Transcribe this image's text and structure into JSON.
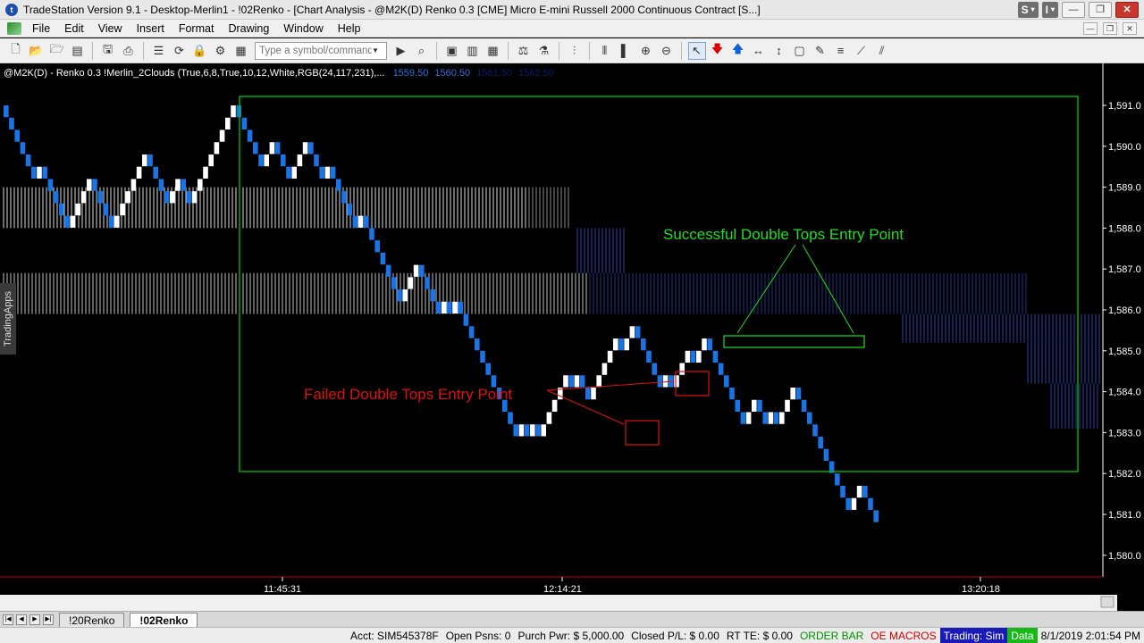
{
  "window": {
    "title": "TradeStation Version 9.1 - Desktop-Merlin1 - !02Renko - [Chart Analysis - @M2K(D) Renko 0.3 [CME] Micro E-mini Russell 2000 Continuous Contract [S...]",
    "pill_s": "S",
    "pill_i": "I"
  },
  "menu": [
    "File",
    "Edit",
    "View",
    "Insert",
    "Format",
    "Drawing",
    "Window",
    "Help"
  ],
  "toolbar": {
    "symbol_placeholder": "Type a symbol/command"
  },
  "chart": {
    "header_text": "@M2K(D) - Renko 0.3  !Merlin_2Clouds (True,6,8,True,10,12,White,RGB(24,117,231),...",
    "header_values": [
      "1559.50",
      "1560.50",
      "1561.50",
      "1562.50"
    ],
    "side_tab": "TradingApps",
    "price_labels": [
      "1,591.0",
      "1,590.0",
      "1,589.0",
      "1,588.0",
      "1,587.0",
      "1,586.0",
      "1,585.0",
      "1,584.0",
      "1,583.0",
      "1,582.0",
      "1,581.0",
      "1,580.0"
    ],
    "time_labels": [
      "11:45:31",
      "12:14:21",
      "13:20:18"
    ],
    "annotation_success": "Successful Double Tops Entry Point",
    "annotation_failed": "Failed Double Tops Entry Point",
    "colors": {
      "up_brick": "#ffffff",
      "down_brick": "#1875e7",
      "cloud_white": "#ffffff",
      "cloud_blue": "#2b3fa6",
      "box": "#00c800",
      "failed": "#e01010",
      "success": "#22dd22"
    }
  },
  "tabs": [
    "!20Renko",
    "!02Renko"
  ],
  "status": {
    "acct": "Acct: SIM545378F",
    "open_psns": "Open Psns: 0",
    "purch_pwr": "Purch Pwr: $ 5,000.00",
    "closed_pl": "Closed P/L: $ 0.00",
    "rt_te": "RT TE: $ 0.00",
    "order_bar": "ORDER BAR",
    "oe_macros": "OE MACROS",
    "trading": "Trading: Sim",
    "data": "Data",
    "datetime": "8/1/2019 2:01:54 PM"
  }
}
